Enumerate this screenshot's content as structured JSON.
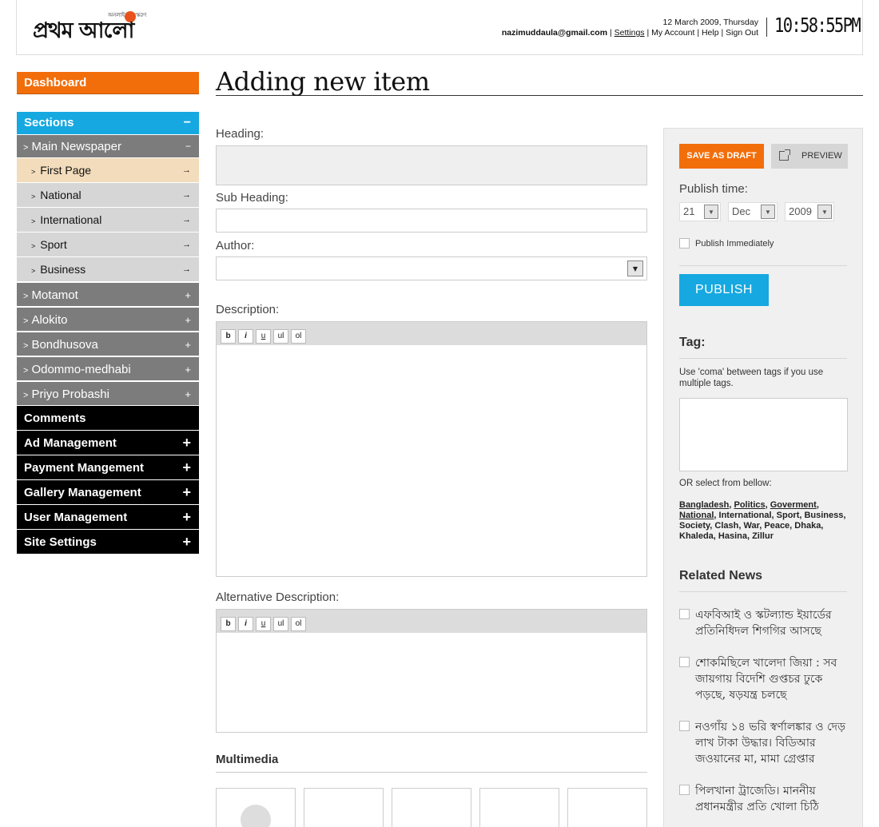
{
  "header": {
    "logo_text": "প্রথম আলো",
    "logo_tagline": "অনলাইন সংস্করণ",
    "date": "12 March 2009, Thursday",
    "email": "nazimuddaula@gmail.com",
    "links": [
      "Settings",
      "My Account",
      "Help",
      "Sign Out"
    ],
    "clock": "10:58:55PM"
  },
  "sidebar": {
    "dashboard": "Dashboard",
    "sections": {
      "label": "Sections",
      "sign": "−"
    },
    "main_newspaper": {
      "label": "Main Newspaper",
      "sign": "−"
    },
    "subitems": [
      "First Page",
      "National",
      "International",
      "Sport",
      "Business"
    ],
    "grey_items": [
      "Motamot",
      "Alokito",
      "Bondhusova",
      "Odommo-medhabi",
      "Priyo Probashi"
    ],
    "black_items": [
      {
        "label": "Comments",
        "sign": ""
      },
      {
        "label": "Ad Management",
        "sign": "+"
      },
      {
        "label": "Payment Mangement",
        "sign": "+"
      },
      {
        "label": "Gallery Management",
        "sign": "+"
      },
      {
        "label": "User Management",
        "sign": "+"
      },
      {
        "label": "Site Settings",
        "sign": "+"
      }
    ]
  },
  "main": {
    "title": "Adding new item",
    "heading_label": "Heading:",
    "subheading_label": "Sub Heading:",
    "author_label": "Author:",
    "description_label": "Description:",
    "alt_description_label": "Alternative Description:",
    "toolbar": [
      "b",
      "i",
      "u",
      "ul",
      "ol"
    ],
    "multimedia_label": "Multimedia"
  },
  "panel": {
    "save_draft": "SAVE AS DRAFT",
    "preview": "PREVIEW",
    "publish_time_label": "Publish time:",
    "day": "21",
    "month": "Dec",
    "year": "2009",
    "publish_immediately": "Publish Immediately",
    "publish": "PUBLISH",
    "tag_title": "Tag:",
    "tag_help": "Use 'coma' between tags if you use multiple tags.",
    "tag_or": "OR select from bellow:",
    "tag_links": [
      "Bangladesh",
      "Politics",
      "Goverment",
      "National"
    ],
    "tag_rest": ", International, Sport, Business, Society, Clash, War, Peace, Dhaka, Khaleda, Hasina, Zillur",
    "related_title": "Related News",
    "related": [
      "এফবিআই ও স্কটল্যান্ড ইয়ার্ডের প্রতিনিধিদল শিগগির আসছে",
      "শোকমিছিলে খালেদা জিয়া : সব জায়গায় বিদেশি গুপ্তচর ঢুকে পড়ছে, ষড়যন্ত্র চলছে",
      "নওগাঁয় ১৪ ভরি স্বর্ণালঙ্কার ও দেড় লাখ টাকা উদ্ধার। বিডিআর জওয়ানের মা, মামা গ্রেপ্তার",
      "পিলখানা ট্রাজেডি। মাননীয় প্রধানমন্ত্রীর প্রতি খোলা চিঠি"
    ]
  }
}
